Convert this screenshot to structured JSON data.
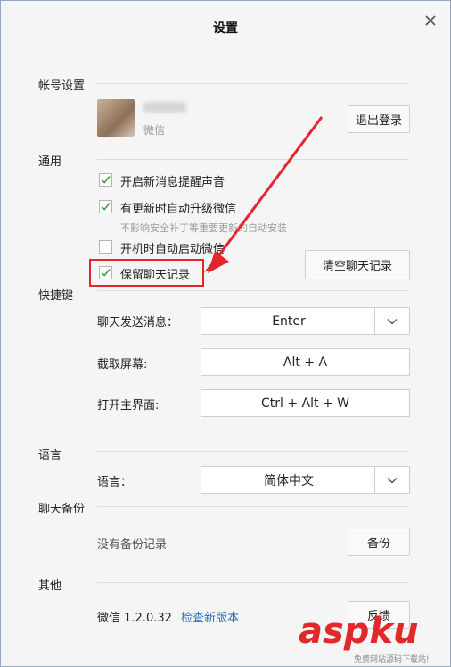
{
  "window": {
    "title": "设置"
  },
  "account": {
    "section_label": "帐号设置",
    "wechat_id_prefix": "微信",
    "logout_label": "退出登录"
  },
  "general": {
    "section_label": "通用",
    "options": [
      {
        "label": "开启新消息提醒声音",
        "checked": true
      },
      {
        "label": "有更新时自动升级微信",
        "checked": true,
        "hint": "不影响安全补丁等重要更新的自动安装"
      },
      {
        "label": "开机时自动启动微信",
        "checked": false
      },
      {
        "label": "保留聊天记录",
        "checked": true
      }
    ],
    "clear_history_label": "清空聊天记录"
  },
  "shortcuts": {
    "section_label": "快捷键",
    "items": [
      {
        "label": "聊天发送消息：",
        "value": "Enter"
      },
      {
        "label": "截取屏幕:",
        "value": "Alt + A"
      },
      {
        "label": "打开主界面:",
        "value": "Ctrl + Alt + W"
      }
    ]
  },
  "language": {
    "section_label": "语言",
    "label": "语言：",
    "value": "简体中文"
  },
  "backup": {
    "section_label": "聊天备份",
    "status": "没有备份记录",
    "backup_label": "备份"
  },
  "other": {
    "section_label": "其他",
    "version": "微信 1.2.0.32",
    "check_update_label": "检查新版本",
    "feedback_label": "反馈"
  },
  "watermark": {
    "logo": "aspku",
    "sub": "免费网站源码下载站!"
  },
  "colors": {
    "accent_link": "#2a6bbd",
    "annotation_red": "#e3262e",
    "checkmark_green": "#3a9b3a"
  }
}
